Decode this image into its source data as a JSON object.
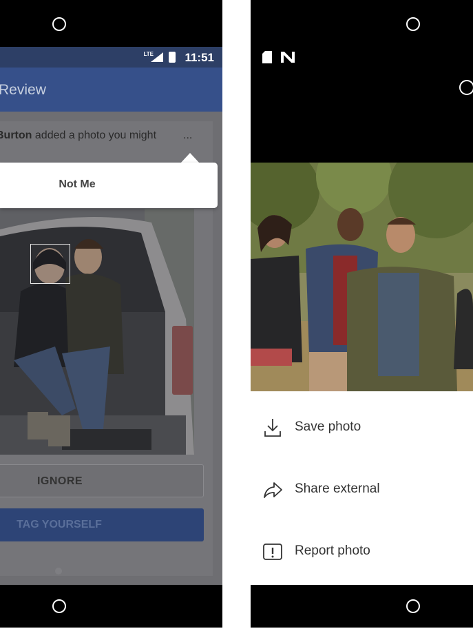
{
  "left_screen": {
    "status_bar": {
      "network": "LTE",
      "time": "11:51"
    },
    "header": {
      "title": "Review"
    },
    "notification": {
      "name": "Burton",
      "text": "added a photo you might",
      "more": "..."
    },
    "popup": {
      "not_me_label": "Not Me"
    },
    "buttons": {
      "ignore": "IGNORE",
      "tag_yourself": "TAG YOURSELF"
    }
  },
  "right_screen": {
    "menu": [
      {
        "label": "Save photo",
        "icon": "download-icon"
      },
      {
        "label": "Share external",
        "icon": "share-icon"
      },
      {
        "label": "Report photo",
        "icon": "report-icon"
      }
    ]
  },
  "colors": {
    "facebook_blue": "#36508a",
    "status_bar": "#2d3f66",
    "dim_overlay": "#6e6e72"
  }
}
